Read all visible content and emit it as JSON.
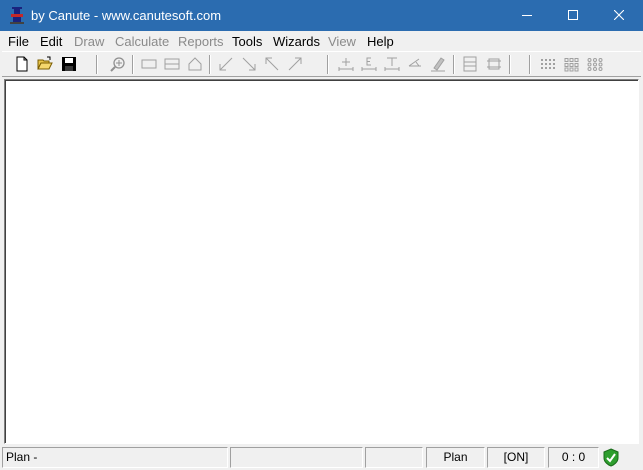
{
  "window": {
    "title": "by Canute - www.canutesoft.com",
    "titlebar_color": "#2b6cb0"
  },
  "menu": {
    "items": [
      {
        "label": "File",
        "enabled": true
      },
      {
        "label": "Edit",
        "enabled": true
      },
      {
        "label": "Draw",
        "enabled": false
      },
      {
        "label": "Calculate",
        "enabled": false
      },
      {
        "label": "Reports",
        "enabled": false
      },
      {
        "label": "Tools",
        "enabled": true
      },
      {
        "label": "Wizards",
        "enabled": true
      },
      {
        "label": "View",
        "enabled": false
      },
      {
        "label": "Help",
        "enabled": true
      }
    ]
  },
  "toolbar": {
    "buttons": [
      {
        "icon": "new-document-icon",
        "enabled": true
      },
      {
        "icon": "open-folder-icon",
        "enabled": true
      },
      {
        "icon": "save-disk-icon",
        "enabled": true
      },
      {
        "icon": "zoom-icon",
        "enabled": false
      },
      {
        "icon": "rectangle-icon",
        "enabled": false
      },
      {
        "icon": "split-rectangle-icon",
        "enabled": false
      },
      {
        "icon": "house-icon",
        "enabled": false
      },
      {
        "icon": "arrow-down-left-icon",
        "enabled": false
      },
      {
        "icon": "arrow-down-right-icon",
        "enabled": false
      },
      {
        "icon": "arrow-up-left-icon",
        "enabled": false
      },
      {
        "icon": "arrow-up-right-icon",
        "enabled": false
      },
      {
        "icon": "dimension-plus-icon",
        "enabled": false
      },
      {
        "icon": "dimension-e-icon",
        "enabled": false
      },
      {
        "icon": "dimension-t-icon",
        "enabled": false
      },
      {
        "icon": "dimension-angle-icon",
        "enabled": false
      },
      {
        "icon": "eraser-icon",
        "enabled": false
      },
      {
        "icon": "layers-icon",
        "enabled": false
      },
      {
        "icon": "stretch-icon",
        "enabled": false
      },
      {
        "icon": "grid-dense-icon",
        "enabled": false
      },
      {
        "icon": "grid-medium-icon",
        "enabled": false
      },
      {
        "icon": "grid-sparse-icon",
        "enabled": false
      }
    ]
  },
  "status": {
    "message": "Plan -",
    "panel2": "",
    "panel3": "",
    "mode": "Plan",
    "toggle": "[ON]",
    "coords": "0 : 0",
    "status_icon": "check-ok-icon",
    "ok_color": "#2e9e2e"
  }
}
